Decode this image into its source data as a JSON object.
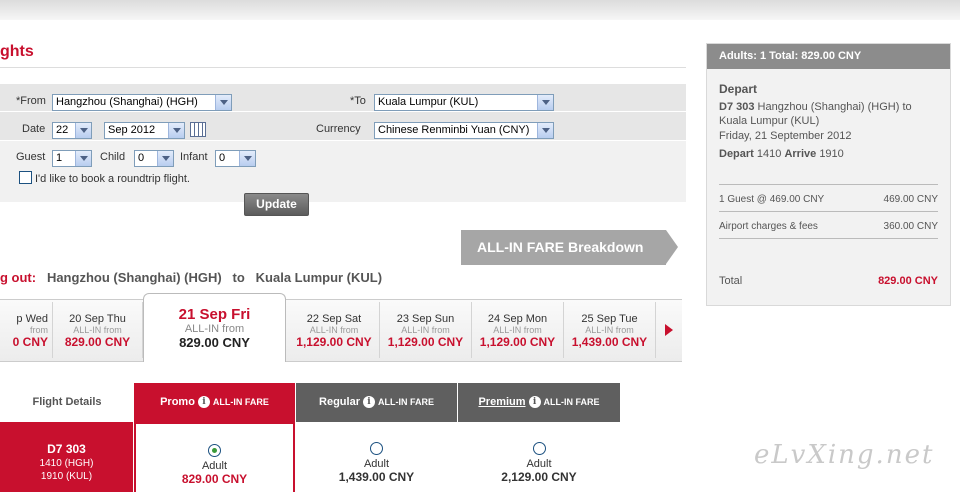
{
  "page": {
    "title": "ghts"
  },
  "form": {
    "from_label": "*From",
    "from_value": "Hangzhou (Shanghai) (HGH)",
    "to_label": "*To",
    "to_value": "Kuala Lumpur (KUL)",
    "date_label": "Date",
    "date_day": "22",
    "date_month": "Sep 2012",
    "currency_label": "Currency",
    "currency_value": "Chinese Renminbi Yuan (CNY)",
    "guest_label": "Guest",
    "guest_value": "1",
    "child_label": "Child",
    "child_value": "0",
    "infant_label": "Infant",
    "infant_value": "0",
    "roundtrip_label": "I'd like to book a roundtrip flight.",
    "update_label": "Update"
  },
  "fare_banner": "ALL-IN FARE Breakdown",
  "route": {
    "lead": "g out:",
    "origin": "Hangzhou (Shanghai) (HGH)",
    "to": "to",
    "destination": "Kuala Lumpur (KUL)"
  },
  "dates": [
    {
      "name": "p Wed",
      "sub": "from",
      "price": "0 CNY"
    },
    {
      "name": "20 Sep Thu",
      "sub": "ALL-IN from",
      "price": "829.00 CNY"
    },
    {
      "name": "21 Sep Fri",
      "sub": "ALL-IN from",
      "price": "829.00 CNY"
    },
    {
      "name": "22 Sep Sat",
      "sub": "ALL-IN from",
      "price": "1,129.00 CNY"
    },
    {
      "name": "23 Sep Sun",
      "sub": "ALL-IN from",
      "price": "1,129.00 CNY"
    },
    {
      "name": "24 Sep Mon",
      "sub": "ALL-IN from",
      "price": "1,129.00 CNY"
    },
    {
      "name": "25 Sep Tue",
      "sub": "ALL-IN from",
      "price": "1,439.00 CNY"
    }
  ],
  "table": {
    "flight_details": "Flight Details",
    "columns": [
      {
        "name": "Promo",
        "info": "i",
        "tag": "ALL-IN FARE",
        "color": "#c8102e"
      },
      {
        "name": "Regular",
        "info": "i",
        "tag": "ALL-IN FARE",
        "color": "#5f5f5f"
      },
      {
        "name": "Premium",
        "info": "i",
        "tag": "ALL-IN FARE",
        "color": "#5f5f5f"
      }
    ],
    "flight": {
      "number": "D7  303",
      "dep": "1410  (HGH)",
      "arr": "1910  (KUL)"
    },
    "options": [
      {
        "who": "Adult",
        "price": "829.00 CNY",
        "selected": true
      },
      {
        "who": "Adult",
        "price": "1,439.00 CNY",
        "selected": false
      },
      {
        "who": "Adult",
        "price": "2,129.00 CNY",
        "selected": false
      }
    ]
  },
  "summary": {
    "header": "Adults: 1  Total: 829.00 CNY",
    "depart_title": "Depart",
    "flight_no": "D7 303",
    "route": "Hangzhou (Shanghai) (HGH) to Kuala Lumpur (KUL)",
    "date": "Friday, 21 September 2012",
    "depart_label": "Depart",
    "depart_time": "1410",
    "arrive_label": "Arrive",
    "arrive_time": "1910",
    "guest_line": "1 Guest @ 469.00 CNY",
    "guest_amount": "469.00 CNY",
    "fees_line": "Airport charges & fees",
    "fees_amount": "360.00 CNY",
    "total_label": "Total",
    "total_amount": "829.00 CNY"
  },
  "watermark": "eLvXing.net"
}
